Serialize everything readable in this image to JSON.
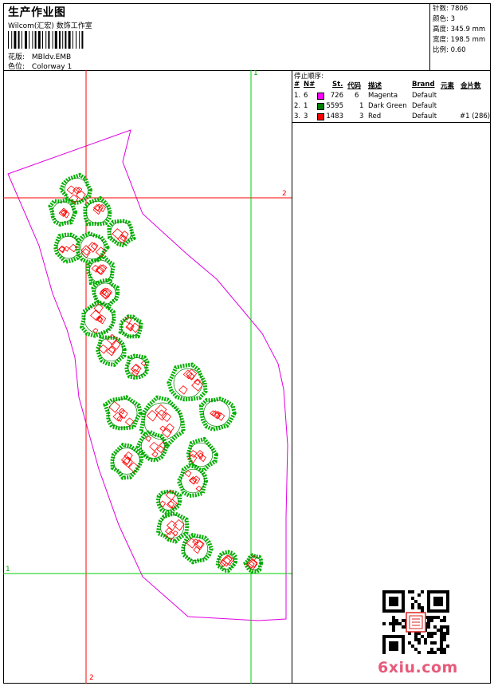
{
  "header": {
    "title": "生产作业图",
    "subtitle": "Wilcom(汇宏) 数饰工作室",
    "design_label": "花版:",
    "design_value": "MBldv.EMB",
    "colorway_label": "色位:",
    "colorway_value": "Colorway 1"
  },
  "stats": [
    {
      "label": "针数:",
      "value": "7806"
    },
    {
      "label": "颜色:",
      "value": "3"
    },
    {
      "label": "高度:",
      "value": "345.9 mm"
    },
    {
      "label": "宽度:",
      "value": "198.5 mm"
    },
    {
      "label": "比例:",
      "value": "0.60"
    }
  ],
  "stop_sequence": {
    "title": "停止顺序:",
    "columns": [
      "#",
      "N#",
      "St.",
      "代码",
      "描述",
      "Brand",
      "元素",
      "金片数"
    ],
    "rows": [
      {
        "idx": "1.",
        "n": "6",
        "color": "#ff00ff",
        "st": "726",
        "code": "6",
        "desc": "Magenta",
        "brand": "Default",
        "extra": ""
      },
      {
        "idx": "2.",
        "n": "1",
        "color": "#008000",
        "st": "5595",
        "code": "1",
        "desc": "Dark Green",
        "brand": "Default",
        "extra": ""
      },
      {
        "idx": "3.",
        "n": "3",
        "color": "#ff0000",
        "st": "1483",
        "code": "3",
        "desc": "Red",
        "brand": "Default",
        "extra": "#1 (286)"
      }
    ]
  },
  "guides": {
    "v_red": "2",
    "v_green": "1",
    "h_red": "2",
    "h_green": "1"
  },
  "colors": {
    "magenta": "#e000e0",
    "green": "#00b000",
    "red": "#ff0000",
    "dark_green": "#008000"
  },
  "watermark": "6xiu.com"
}
